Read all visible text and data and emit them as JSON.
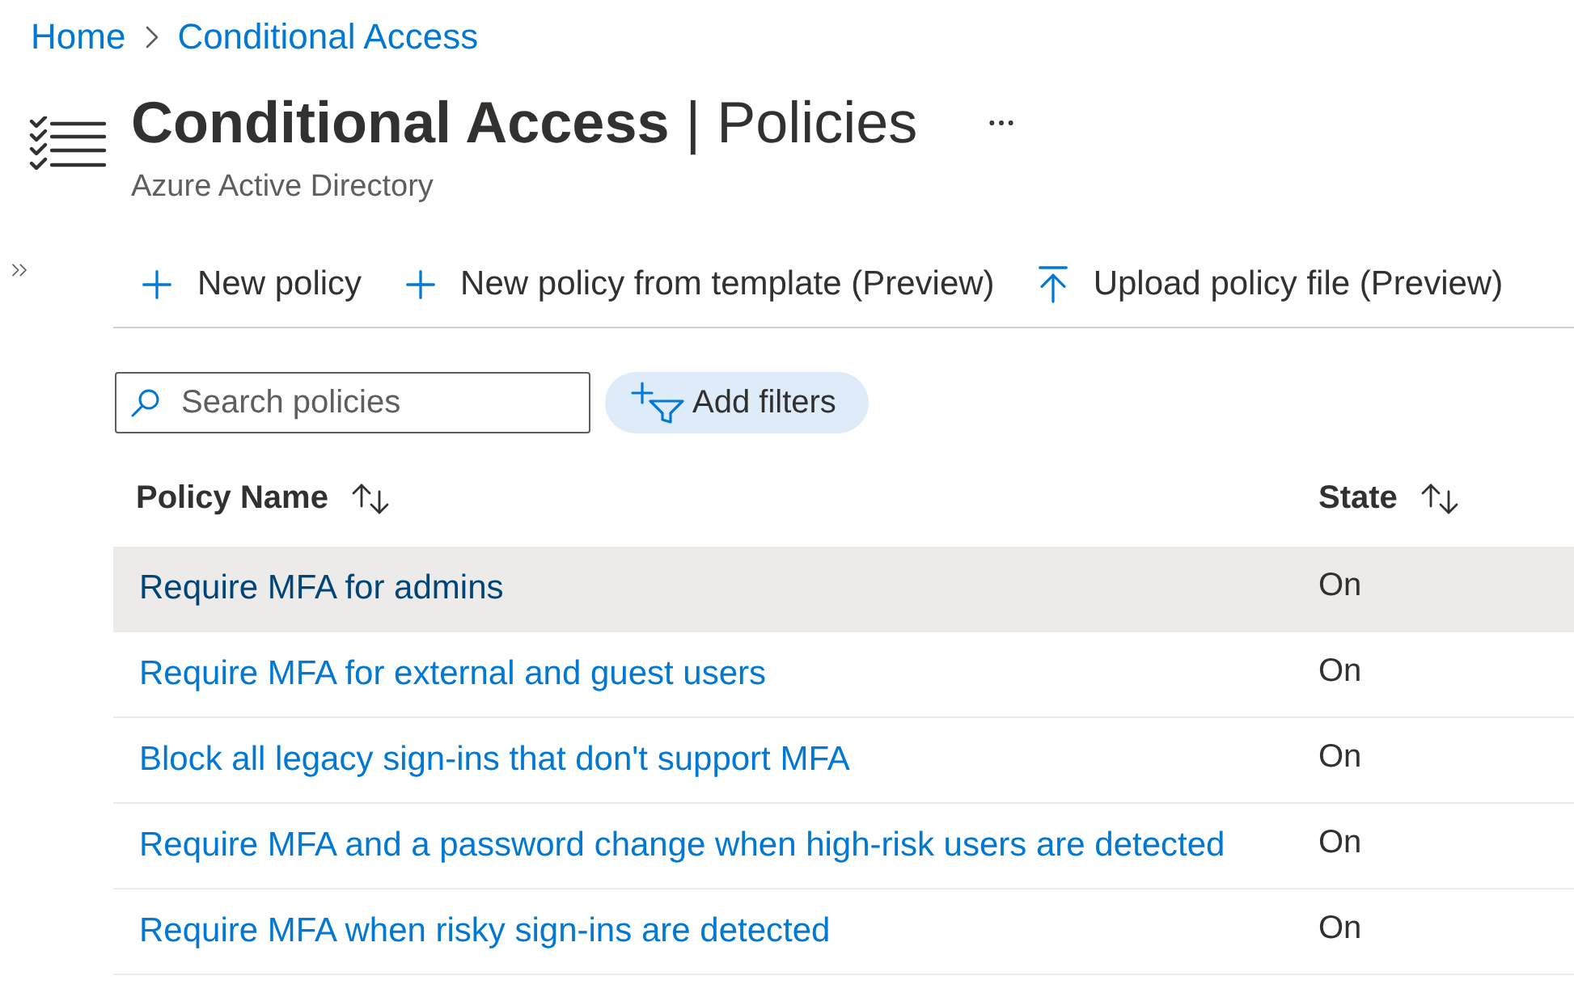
{
  "breadcrumb": [
    {
      "label": "Home"
    },
    {
      "label": "Conditional Access"
    }
  ],
  "header": {
    "title": "**Conditional Access** | Policies",
    "subtitle": "Azure Active Directory"
  },
  "toolbar": [
    {
      "kind": "add",
      "label": "New policy"
    },
    {
      "kind": "add",
      "label": "New policy from template (Preview)"
    },
    {
      "kind": "upload",
      "label": "Upload policy file (Preview)"
    }
  ],
  "search": {
    "placeholder": "Search policies"
  },
  "filter_button": {
    "label": "Add filters"
  },
  "table": {
    "columns": [
      {
        "label": "Policy Name",
        "sortable": true
      },
      {
        "label": "State",
        "sortable": true
      }
    ],
    "rows": [
      {
        "name": "Require MFA for admins",
        "state": "On",
        "selected": true
      },
      {
        "name": "Require MFA for external and guest users",
        "state": "On",
        "selected": false
      },
      {
        "name": "Block all legacy sign-ins that don't support MFA",
        "state": "On",
        "selected": false
      },
      {
        "name": "Require MFA and a password change when high-risk users are detected",
        "state": "On",
        "selected": false
      },
      {
        "name": "Require MFA when risky sign-ins are detected",
        "state": "On",
        "selected": false
      }
    ]
  }
}
